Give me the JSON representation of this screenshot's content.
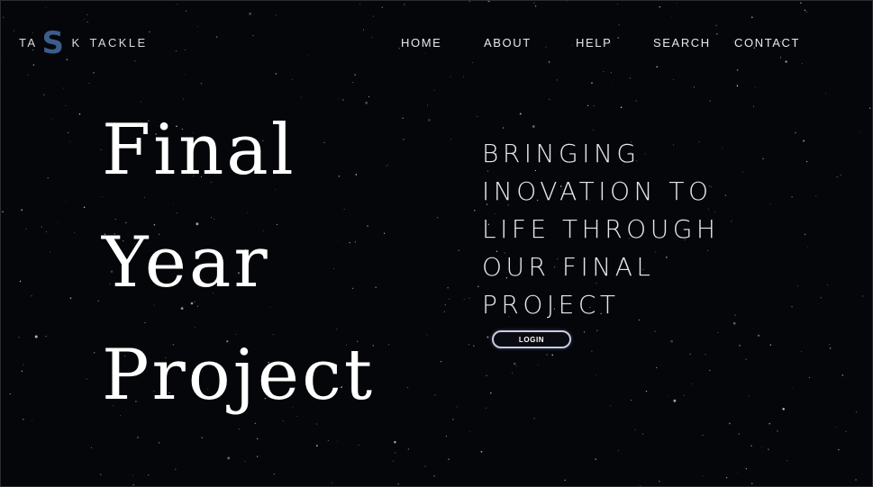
{
  "logo": {
    "prefix": "TA",
    "emblem_letter": "S",
    "suffix": "K",
    "word2": "TACKLE"
  },
  "nav": {
    "items": [
      "HOME",
      "ABOUT",
      "HELP",
      "SEARCH",
      "CONTACT"
    ]
  },
  "hero": {
    "title_lines": [
      "Final",
      "Year",
      "Project"
    ]
  },
  "tagline": {
    "lines": [
      "BRINGING",
      "INOVATION TO",
      "LIFE THROUGH",
      "OUR FINAL",
      "PROJECT"
    ]
  },
  "login": {
    "label": "LOGIN"
  },
  "colors": {
    "background": "#05060a",
    "emblem": "#3c5d8c",
    "text": "#ffffff",
    "button_border": "#c9cde0"
  }
}
